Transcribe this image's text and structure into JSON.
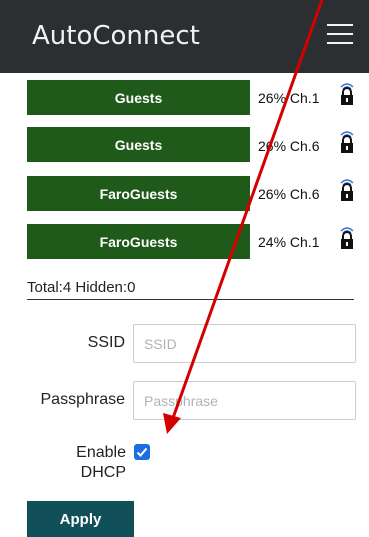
{
  "header": {
    "title": "AutoConnect",
    "menu_icon": "hamburger-menu-icon"
  },
  "access_points": [
    {
      "ssid": "Guests",
      "signal": "26%",
      "channel": "Ch.1",
      "icons": [
        "wifi-signal-icon",
        "lock-icon"
      ]
    },
    {
      "ssid": "Guests",
      "signal": "26%",
      "channel": "Ch.6",
      "icons": [
        "wifi-signal-icon",
        "lock-icon"
      ]
    },
    {
      "ssid": "FaroGuests",
      "signal": "26%",
      "channel": "Ch.6",
      "icons": [
        "wifi-signal-icon",
        "lock-icon"
      ]
    },
    {
      "ssid": "FaroGuests",
      "signal": "24%",
      "channel": "Ch.1",
      "icons": [
        "wifi-signal-icon",
        "lock-icon"
      ]
    }
  ],
  "summary": "Total:4 Hidden:0",
  "form": {
    "ssid_label": "SSID",
    "ssid_placeholder": "SSID",
    "ssid_value": "",
    "pass_label": "Passphrase",
    "pass_placeholder": "Passphrase",
    "pass_value": "",
    "dhcp_label_line1": "Enable",
    "dhcp_label_line2": "DHCP",
    "dhcp_checked": true,
    "apply_label": "Apply"
  },
  "colors": {
    "header_bg": "#2b2f31",
    "ap_button": "#1f5a1b",
    "apply_button": "#125059",
    "checkbox": "#1b6fe2",
    "annotation_arrow": "#d40000"
  }
}
